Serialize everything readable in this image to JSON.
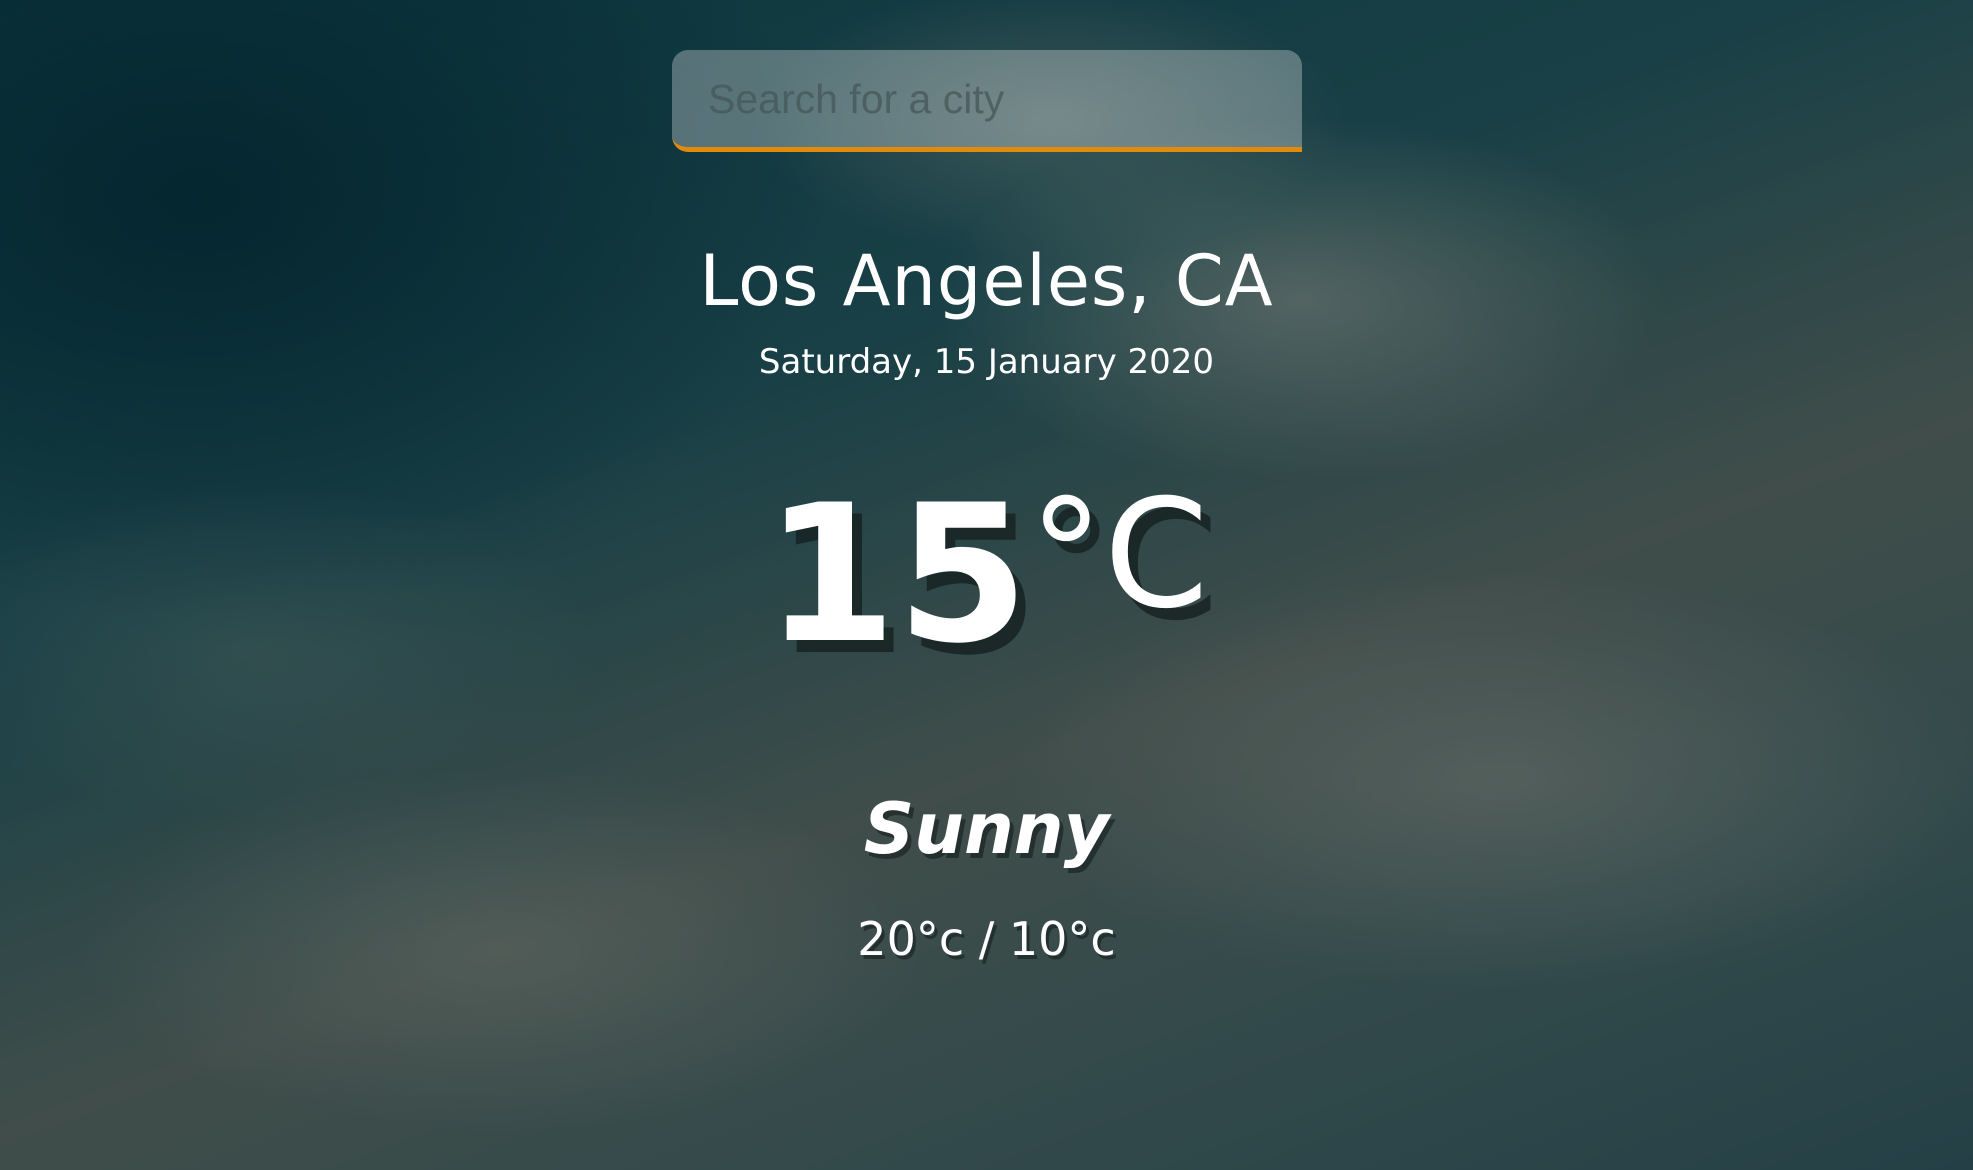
{
  "search": {
    "placeholder": "Search for a city",
    "value": ""
  },
  "location": "Los Angeles, CA",
  "date": "Saturday, 15 January 2020",
  "temperature": {
    "value": "15",
    "unit": "°C"
  },
  "condition": "Sunny",
  "hi_low": "20°c / 10°c",
  "colors": {
    "accent": "#e08b0c",
    "text": "#ffffff"
  }
}
